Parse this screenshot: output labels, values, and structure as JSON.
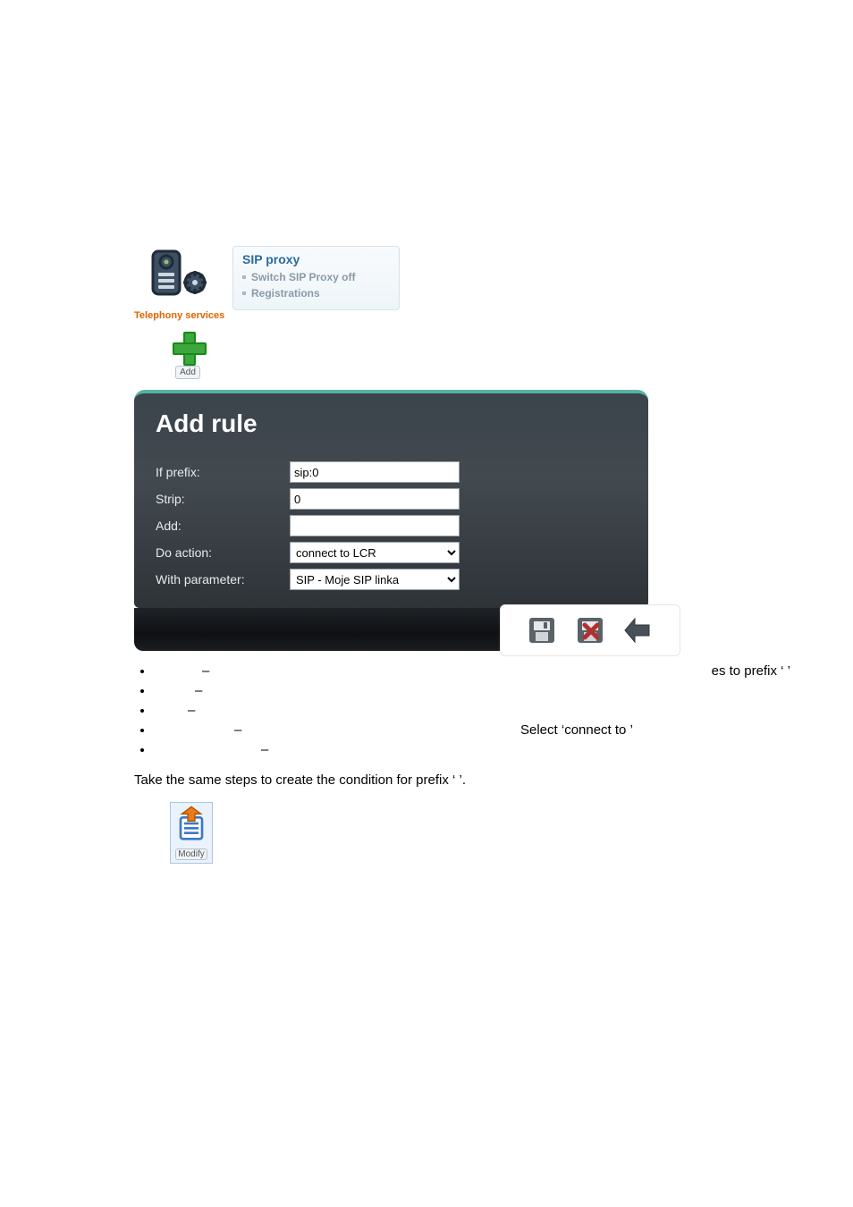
{
  "sip_panel": {
    "icon_label": "Telephony services",
    "title": "SIP proxy",
    "items": [
      "Switch SIP Proxy off",
      "Registrations"
    ]
  },
  "add_button": {
    "label": "Add"
  },
  "rule_panel": {
    "title": "Add rule",
    "rows": {
      "if_prefix": {
        "label": "If prefix:",
        "value": "sip:0"
      },
      "strip": {
        "label": "Strip:",
        "value": "0"
      },
      "add": {
        "label": "Add:",
        "value": ""
      },
      "do_action": {
        "label": "Do action:",
        "value": "connect to LCR"
      },
      "with_parameter": {
        "label": "With parameter:",
        "value": "SIP - Moje SIP linka"
      }
    }
  },
  "hover_icons": {
    "save": "save-icon",
    "cancel": "cancel-icon",
    "back": "back-icon"
  },
  "bullets": {
    "li0": {
      "dash": "–",
      "text": "es to prefix ‘  ’"
    },
    "li1": {
      "dash": "–"
    },
    "li2": {
      "dash": "–"
    },
    "li3": {
      "dash": "–",
      "text": "Select ‘connect to         ’"
    },
    "li4": {
      "dash": "–"
    }
  },
  "paragraph": "Take the same steps to create the condition for prefix ‘  ’.",
  "modify_button": {
    "label": "Modify"
  }
}
